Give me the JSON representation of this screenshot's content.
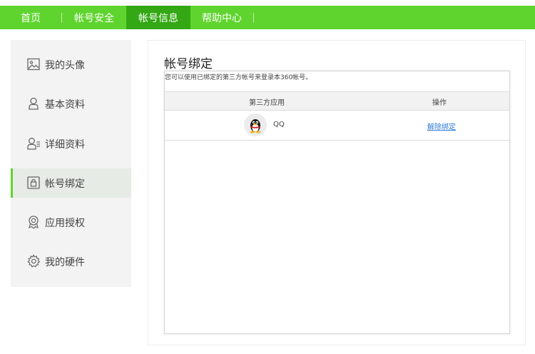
{
  "nav": {
    "tabs": [
      {
        "label": "首页"
      },
      {
        "label": "帐号安全"
      },
      {
        "label": "帐号信息",
        "active": true
      },
      {
        "label": "帮助中心"
      }
    ]
  },
  "sidebar": {
    "items": [
      {
        "label": "我的头像",
        "icon": "image-icon"
      },
      {
        "label": "基本资料",
        "icon": "user-icon"
      },
      {
        "label": "详细资料",
        "icon": "user-detail-icon"
      },
      {
        "label": "帐号绑定",
        "icon": "lock-icon",
        "active": true
      },
      {
        "label": "应用授权",
        "icon": "badge-icon"
      },
      {
        "label": "我的硬件",
        "icon": "gear-icon"
      }
    ]
  },
  "main": {
    "title": "帐号绑定",
    "description": "您可以使用已绑定的第三方帐号来登录本360帐号。",
    "table": {
      "headers": [
        "第三方应用",
        "操作"
      ],
      "rows": [
        {
          "app": "QQ",
          "action": "解除绑定"
        }
      ]
    }
  },
  "colors": {
    "accent": "#5fd42e",
    "active_tab": "#33a814",
    "link": "#2f7bd6"
  }
}
